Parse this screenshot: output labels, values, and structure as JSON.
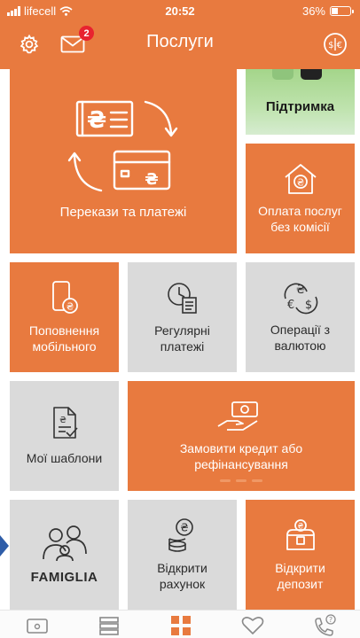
{
  "status_bar": {
    "carrier": "lifecell",
    "time": "20:52",
    "battery": "36%",
    "battery_level": 0.36
  },
  "header": {
    "title": "Послуги",
    "notifications_count": "2",
    "icons": [
      "gear-icon",
      "mail-icon",
      "currency-exchange-icon"
    ]
  },
  "tiles": {
    "transfers": "Перекази та платежі",
    "support": "Підтримка",
    "free_payments": "Оплата послуг без комісії",
    "mobile_topup": "Поповнення мобільного",
    "regular_payments": "Регулярні платежі",
    "currency_operations": "Операції з валютою",
    "my_templates": "Мої шаблони",
    "credit": "Замовити кредит або рефінансування",
    "famiglia": "FAMIGLIA",
    "open_account": "Відкрити рахунок",
    "open_deposit": "Відкрити депозит"
  },
  "tab_bar": {
    "items": [
      "wallet-icon",
      "list-icon",
      "grid-icon",
      "heart-icon",
      "phone-help-icon"
    ],
    "active": "grid-icon"
  },
  "colors": {
    "brand_orange": "#e87a3f",
    "tile_grey": "#dadada",
    "badge_red": "#e8232f"
  }
}
